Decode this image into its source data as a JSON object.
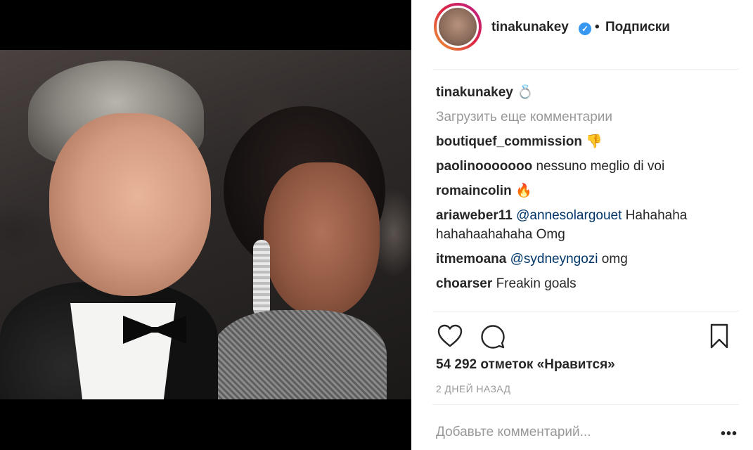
{
  "post": {
    "header": {
      "username": "tinakunakey",
      "verified_symbol": "✓",
      "separator": "•",
      "follow_label": "Подписки"
    },
    "caption": {
      "username": "tinakunakey",
      "text": "💍"
    },
    "load_more": "Загрузить еще комментарии",
    "comments": [
      {
        "username": "boutiquef_commission",
        "mention": "",
        "text": "👎"
      },
      {
        "username": "paolinooooooo",
        "mention": "",
        "text": "nessuno meglio di voi"
      },
      {
        "username": "romaincolin",
        "mention": "",
        "text": "🔥"
      },
      {
        "username": "ariaweber11",
        "mention": "@annesolargouet",
        "text": "Hahahaha hahahaahahaha Omg"
      },
      {
        "username": "itmemoana",
        "mention": "@sydneyngozi",
        "text": "omg"
      },
      {
        "username": "choarser",
        "mention": "",
        "text": "Freakin goals"
      }
    ],
    "likes": "54 292 отметок «Нравится»",
    "date": "2 ДНЕЙ НАЗАД",
    "add_comment_placeholder": "Добавьте комментарий...",
    "more_options": "•••",
    "icons": [
      "heart-icon",
      "comment-icon",
      "bookmark-icon"
    ],
    "colors": {
      "accent": "#3897f0",
      "mention": "#003569",
      "muted": "#999999"
    }
  }
}
